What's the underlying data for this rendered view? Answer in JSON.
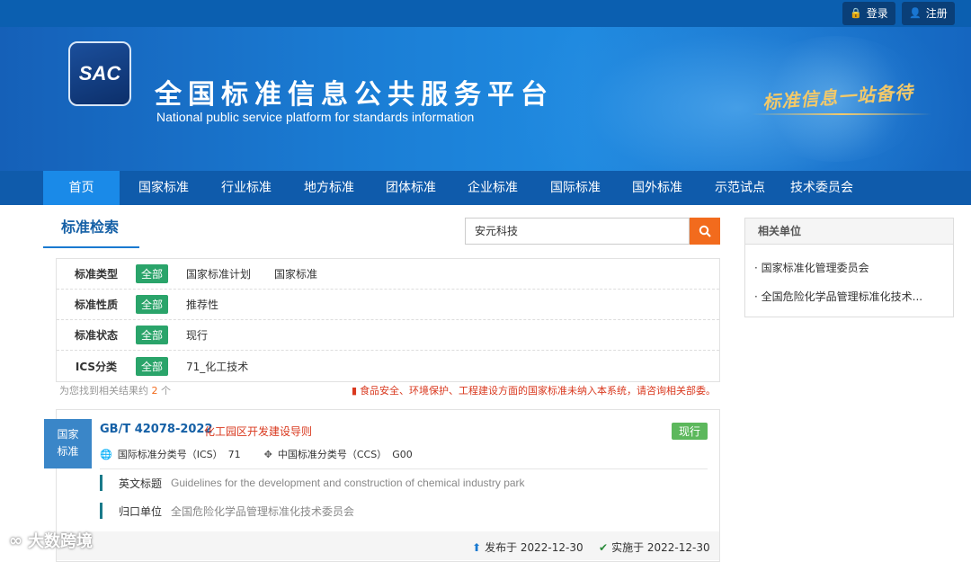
{
  "header": {
    "login_label": "登录",
    "register_label": "注册",
    "logo_text": "SAC",
    "title": "全国标准信息公共服务平台",
    "subtitle": "National public service platform  for standards information",
    "slogan": "标准信息一站备待"
  },
  "nav": {
    "items": [
      "首页",
      "国家标准",
      "行业标准",
      "地方标准",
      "团体标准",
      "企业标准",
      "国际标准",
      "国外标准",
      "示范试点",
      "技术委员会"
    ],
    "active_index": 0
  },
  "search": {
    "tab_label": "标准检索",
    "query": "安元科技",
    "button_icon": "search-icon"
  },
  "filters": [
    {
      "label": "标准类型",
      "tag": "全部",
      "values": [
        "国家标准计划",
        "国家标准"
      ]
    },
    {
      "label": "标准性质",
      "tag": "全部",
      "values": [
        "推荐性"
      ]
    },
    {
      "label": "标准状态",
      "tag": "全部",
      "values": [
        "现行"
      ]
    },
    {
      "label": "ICS分类",
      "tag": "全部",
      "values": [
        "71_化工技术"
      ]
    }
  ],
  "results": {
    "note_prefix": "为您找到相关结果约",
    "count": "2",
    "note_suffix": "个",
    "warning": "食品安全、环境保护、工程建设方面的国家标准未纳入本系统，请咨询相关部委。"
  },
  "result_card": {
    "badge_line1": "国家",
    "badge_line2": "标准",
    "std_no": "GB/T 42078-2022",
    "std_name": "化工园区开发建设导则",
    "status": "现行",
    "ics_label": "国际标准分类号（ICS）",
    "ics_value": "71",
    "ccs_label": "中国标准分类号（CCS）",
    "ccs_value": "G00",
    "en_title_label": "英文标题",
    "en_title_value": "Guidelines for the development and construction of chemical industry park",
    "dept_label": "归口单位",
    "dept_value": "全国危险化学品管理标准化技术委员会",
    "publish_label": "发布于 2022-12-30",
    "implement_label": "实施于 2022-12-30"
  },
  "sidebar": {
    "title": "相关单位",
    "items": [
      "· 国家标准化管理委员会",
      "· 全国危险化学品管理标准化技术..."
    ]
  },
  "watermark": "大数跨境",
  "colors": {
    "brand_blue": "#0f5bab",
    "accent_orange": "#f26b1d",
    "tag_green": "#2aa46a",
    "status_green": "#5cb85c",
    "warning_red": "#d9381e"
  }
}
